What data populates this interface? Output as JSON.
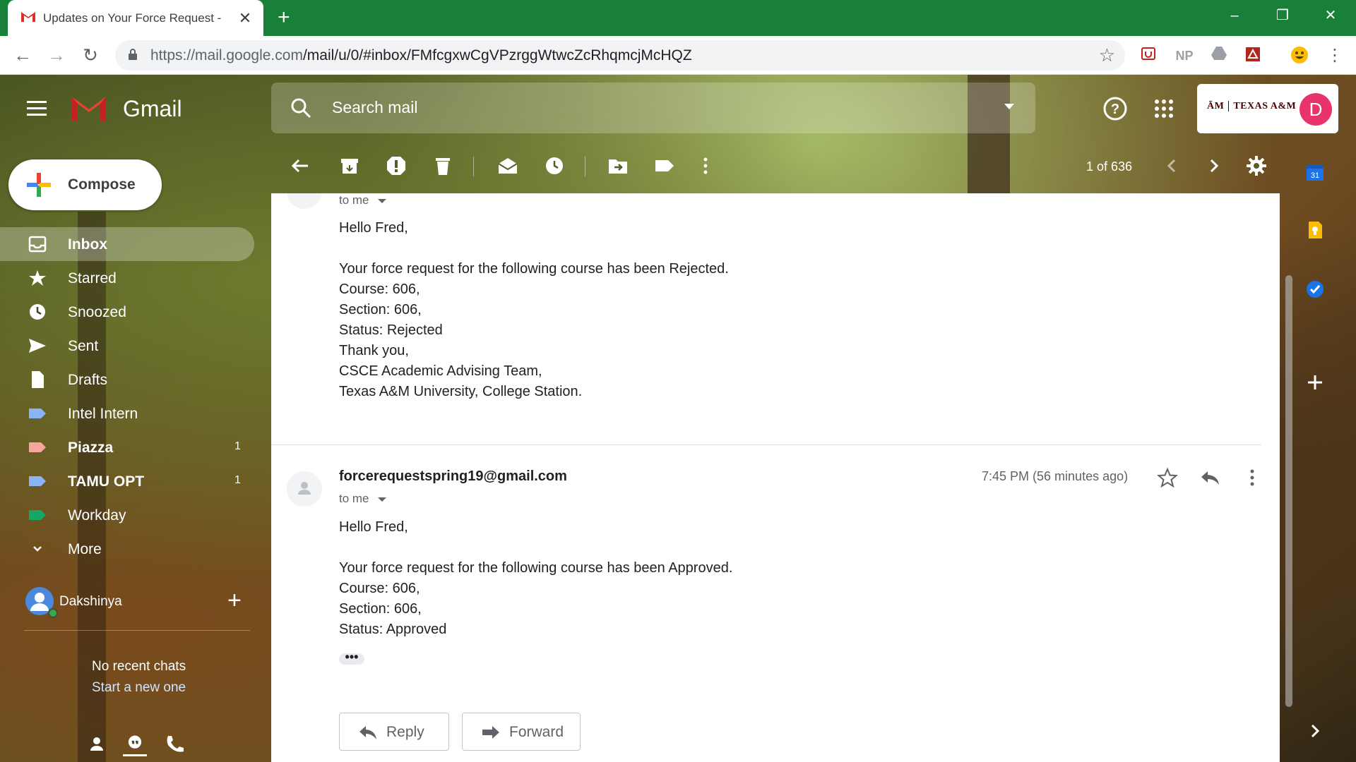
{
  "browser": {
    "tab_title": "Updates on Your Force Request -",
    "url_host": "https://mail.google.com",
    "url_path": "/mail/u/0/#inbox/FMfcgxwCgVPzrggWtwcZcRhqmcjMcHQZ",
    "extensions": [
      "NP"
    ]
  },
  "header": {
    "app_name": "Gmail",
    "search_placeholder": "Search mail",
    "account_org": "TEXAS A&M",
    "avatar_letter": "D"
  },
  "sidebar": {
    "compose_label": "Compose",
    "items": [
      {
        "label": "Inbox",
        "count": ""
      },
      {
        "label": "Starred",
        "count": ""
      },
      {
        "label": "Snoozed",
        "count": ""
      },
      {
        "label": "Sent",
        "count": ""
      },
      {
        "label": "Drafts",
        "count": ""
      },
      {
        "label": "Intel Intern",
        "count": "",
        "color": "#8ab4f8"
      },
      {
        "label": "Piazza",
        "count": "1",
        "color": "#f6a69a"
      },
      {
        "label": "TAMU OPT",
        "count": "1",
        "color": "#8ab4f8"
      },
      {
        "label": "Workday",
        "count": "",
        "color": "#16a765"
      },
      {
        "label": "More",
        "count": ""
      }
    ],
    "chat_user": "Dakshinya",
    "no_chats": "No recent chats",
    "start_new": "Start a new one"
  },
  "toolbar": {
    "page_count": "1 of 636"
  },
  "messages": [
    {
      "to": "to me",
      "body": [
        "Hello Fred,",
        "",
        "Your force request for the following course has been Rejected.",
        "Course: 606,",
        "Section: 606,",
        "Status: Rejected",
        "Thank you,",
        "CSCE Academic Advising Team,",
        "Texas A&M University, College Station."
      ]
    },
    {
      "sender": "forcerequestspring19@gmail.com",
      "time": "7:45 PM (56 minutes ago)",
      "to": "to me",
      "body": [
        "Hello Fred,",
        "",
        "Your force request for the following course has been Approved.",
        "Course: 606,",
        "Section: 606,",
        "Status: Approved"
      ],
      "ellipsis": "•••"
    }
  ],
  "actions": {
    "reply": "Reply",
    "forward": "Forward"
  },
  "side_panel": {
    "calendar_day": "31"
  },
  "colors": {
    "chrome_green": "#188038",
    "accent_red": "#d93025",
    "avatar_pink": "#e8336b"
  }
}
